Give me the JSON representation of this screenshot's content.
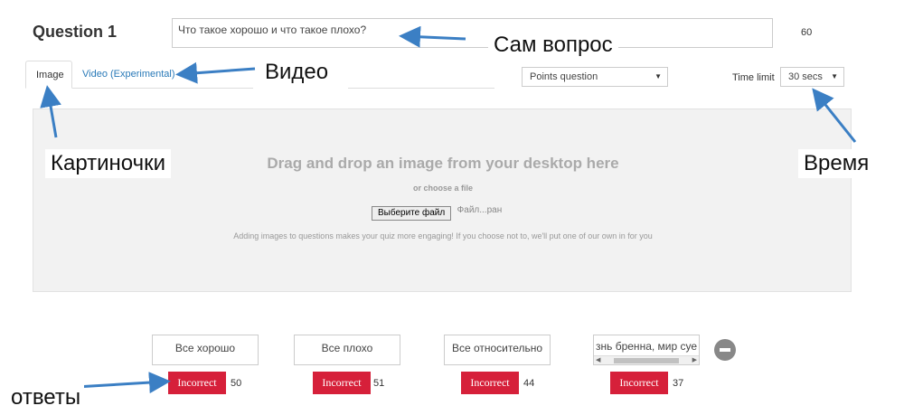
{
  "question": {
    "title": "Question 1",
    "text": "Что такое хорошо и что такое плохо?",
    "char_count": "60"
  },
  "tabs": [
    {
      "label": "Image",
      "active": true
    },
    {
      "label": "Video (Experimental)",
      "active": false
    }
  ],
  "question_type": {
    "selected": "Points question"
  },
  "time_limit": {
    "label": "Time limit",
    "selected": "30 secs"
  },
  "dropzone": {
    "title": "Drag and drop an image from your desktop here",
    "or_text": "or choose a file",
    "file_button": "Выберите файл",
    "file_status": "Файл...ран",
    "note": "Adding images to questions makes your quiz more engaging! If you choose not to, we'll put one of our own in for you"
  },
  "answers": [
    {
      "text": "Все хорошо",
      "status": "Incorrect",
      "count": "50"
    },
    {
      "text": "Все плохо",
      "status": "Incorrect",
      "count": "51"
    },
    {
      "text": "Все относительно",
      "status": "Incorrect",
      "count": "44"
    },
    {
      "text": "знь бренна, мир суе",
      "status": "Incorrect",
      "count": "37"
    }
  ],
  "annotations": {
    "question": "Сам вопрос",
    "video": "Видео",
    "images": "Картиночки",
    "time": "Время",
    "answers": "ответы"
  },
  "colors": {
    "incorrect": "#d6203a",
    "link": "#2a7ab8",
    "arrow": "#3b7fc4"
  }
}
